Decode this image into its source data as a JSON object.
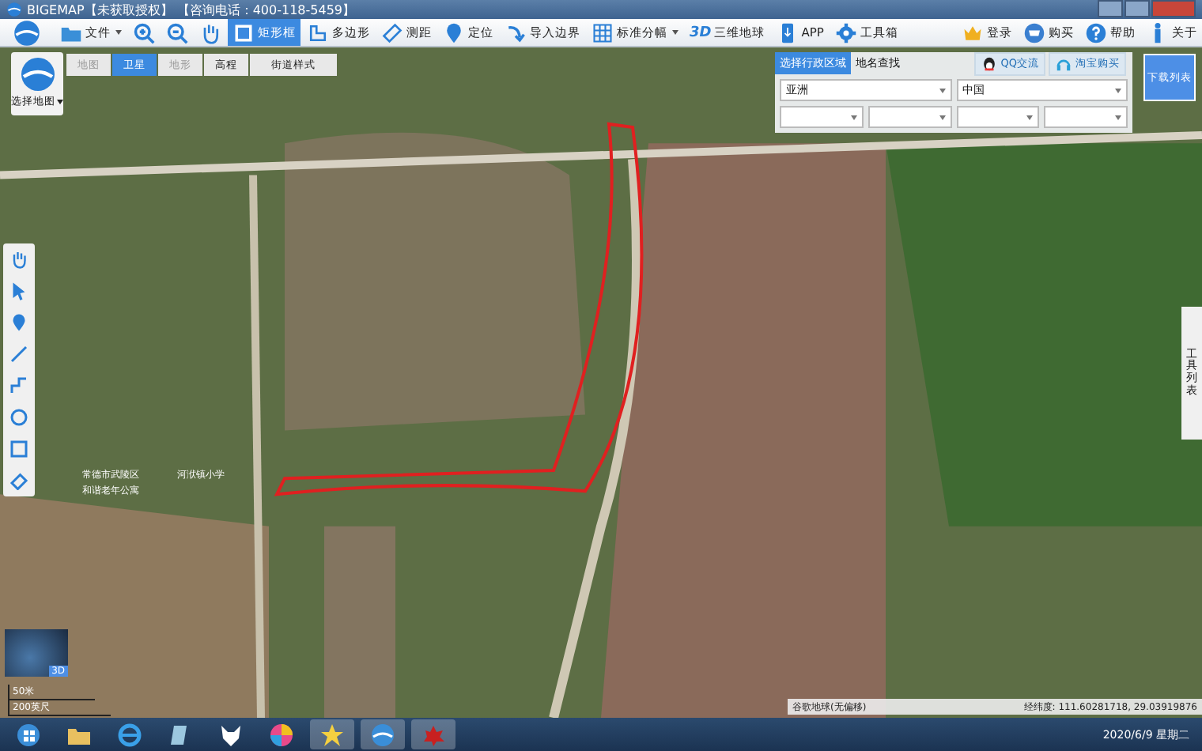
{
  "window": {
    "title": "BIGEMAP【未获取授权】 【咨询电话：400-118-5459】"
  },
  "toolbar": {
    "items": [
      {
        "kind": "icon"
      },
      {
        "kind": "menu",
        "label": "文件",
        "selected": false
      },
      {
        "kind": "icon",
        "selected": false
      },
      {
        "kind": "icon",
        "selected": false
      },
      {
        "kind": "icon",
        "selected": false
      },
      {
        "kind": "button",
        "label": "矩形框",
        "selected": true
      },
      {
        "kind": "button",
        "label": "多边形",
        "selected": false
      },
      {
        "kind": "button",
        "label": "测距",
        "selected": false
      },
      {
        "kind": "button",
        "label": "定位",
        "selected": false
      },
      {
        "kind": "button",
        "label": "导入边界",
        "selected": false
      },
      {
        "kind": "menu",
        "label": "标准分幅",
        "selected": false
      },
      {
        "kind": "button",
        "badge": "3D",
        "label": "三维地球",
        "selected": false
      },
      {
        "kind": "button",
        "label": "APP",
        "selected": false
      },
      {
        "kind": "button",
        "label": "工具箱",
        "selected": false
      }
    ],
    "right_items": [
      {
        "label": "登录"
      },
      {
        "label": "购买"
      },
      {
        "label": "帮助"
      },
      {
        "label": "关于"
      }
    ]
  },
  "map_picker": {
    "label": "选择地图"
  },
  "map_types": [
    {
      "label": "地图",
      "selected": false
    },
    {
      "label": "卫星",
      "selected": true
    },
    {
      "label": "地形",
      "selected": false
    },
    {
      "label": "高程",
      "selected": false
    },
    {
      "label": "街道样式",
      "selected": false
    }
  ],
  "region_panel": {
    "tabs": [
      {
        "label": "选择行政区域",
        "selected": true
      },
      {
        "label": "地名查找",
        "selected": false
      }
    ],
    "buttons": [
      {
        "label": "QQ交流"
      },
      {
        "label": "淘宝购买"
      }
    ],
    "selects": [
      "亚洲",
      "中国"
    ]
  },
  "download_list": {
    "label": "下载列表"
  },
  "tool_list": {
    "label": "工具列表"
  },
  "map_labels": [
    {
      "text": "常德市武陵区",
      "kind": "place"
    },
    {
      "text": "和谐老年公寓",
      "kind": "place"
    },
    {
      "text": "河洑镇小学",
      "kind": "place"
    }
  ],
  "globe": {
    "label": "3D"
  },
  "scale": {
    "metric": "50米",
    "imperial": "200英尺"
  },
  "status_bar": {
    "source": "谷歌地球(无偏移)",
    "coords": "经纬度: 111.60281718, 29.03919876"
  },
  "taskbar": {
    "clock": "2020/6/9 星期二"
  }
}
